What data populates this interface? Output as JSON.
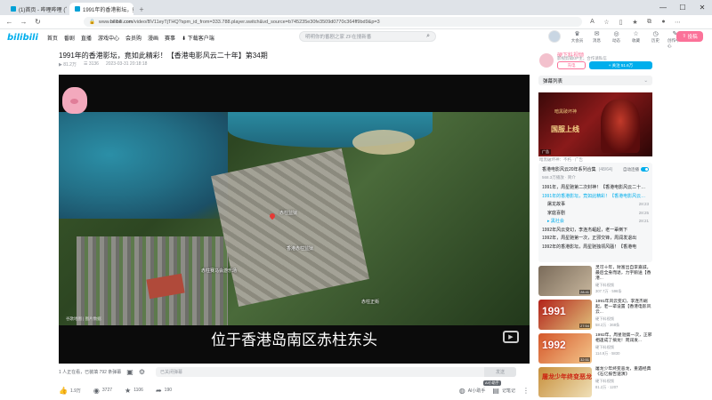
{
  "browser": {
    "tabs": [
      {
        "label": "(1)首页 - 哔哩哔哩 (゜-゜)つロ 干杯~-bilibili",
        "active": false
      },
      {
        "label": "1991年的香港影坛，竟如此精彩",
        "active": true
      }
    ],
    "url_prefix": "www.",
    "url_host": "bilibili.com",
    "url_rest": "/video/BV11eyTjTHQ?spm_id_from=333.788.player.switch&vd_source=b745235e30fe3509d0770c364ff9bd9&p=3"
  },
  "header": {
    "logo": "bilibili",
    "nav": [
      "首页",
      "番剧",
      "直播",
      "游戏中心",
      "会员购",
      "漫画",
      "赛事",
      "下载客户端"
    ],
    "search_placeholder": "明明你的番剧之家 ZF在搜新番",
    "icons": [
      {
        "label": "大会员"
      },
      {
        "label": "消息"
      },
      {
        "label": "动态"
      },
      {
        "label": "收藏"
      },
      {
        "label": "历史"
      },
      {
        "label": "创作中心"
      }
    ],
    "upload_label": "投稿"
  },
  "video": {
    "title": "1991年的香港影坛，竟如此精彩！【香港电影风云二十年】第34期",
    "views": "81.2万",
    "danmaku_count": "3136",
    "date": "2023-03-31 20:18:18",
    "subtitle": "位于香港岛南区赤柱东头",
    "map_labels": [
      "赤柱监狱",
      "香港赤柱监狱",
      "赤柱正街",
      "赤柱赛马会游乐场"
    ],
    "watermark": "谷歌地图 | 图片数据"
  },
  "danmaku_bar": {
    "status": "1 人正在看，已装填 792 条弹幕",
    "placeholder": "已关闭弹幕",
    "send": "发送"
  },
  "toolbar": {
    "like": "1.9万",
    "coin": "3727",
    "fav": "1106",
    "share": "190",
    "ai_badge": "AI小助手",
    "ai_label": "AI小助手",
    "notes": "记笔记",
    "more": "举报"
  },
  "up": {
    "name": "硬下料视频",
    "desc": "影视剪辑UP主，合作请私信",
    "charge": "充电",
    "follow": "+ 关注 51.6万"
  },
  "danmaku_list": {
    "label": "弹幕列表"
  },
  "ad": {
    "brand": "暗黑破坏神",
    "headline": "国服上线",
    "tag": "广告",
    "caption": "暗黑破坏神：不朽 · 广告"
  },
  "collection": {
    "title": "香港电影风云20年系列合集",
    "count": "(48/64)",
    "autoplay": "自动连播",
    "sub": "568.3万播放 · 简介",
    "episodes": [
      {
        "title": "1991年，周星驰第二次封神！【香港电影风云二十年】",
        "dur": "",
        "active": false,
        "sub": false
      },
      {
        "title": "1991年的香港影坛，竟如此精彩！【香港电影风云二十年】",
        "dur": "",
        "active": true,
        "sub": false
      },
      {
        "title": "屠龙故事",
        "dur": "28:23",
        "active": false,
        "sub": true
      },
      {
        "title": "家庭喜剧",
        "dur": "28:25",
        "active": false,
        "sub": true
      },
      {
        "title": "▸ 黑社会",
        "dur": "28:21",
        "active": true,
        "sub": true
      },
      {
        "title": "1992年风云变幻，李连杰崛起，老一辈倒下",
        "dur": "",
        "active": false,
        "sub": false
      },
      {
        "title": "1992年，周星驰第一次，正邪交锋，周润发退出",
        "dur": "",
        "active": false,
        "sub": false
      },
      {
        "title": "1992年的香港影坛，周星驰独领风骚！【香港电",
        "dur": "",
        "active": false,
        "sub": false
      }
    ]
  },
  "recommendations": [
    {
      "title": "灵可十年，财富出自李嘉诚，最后全身而退，力宇鹅送【香港...",
      "up": "硬下料视频",
      "stats": "307.7万 · 596条",
      "dur": "28:41",
      "big": ""
    },
    {
      "title": "1991年风云变幻，李连杰崛起，老一辈设置【香港电影风云...",
      "up": "硬下料视频",
      "stats": "58.2万 · 368条",
      "dur": "27:54",
      "big": "1991"
    },
    {
      "title": "1992年，周星驰第一次，正邪相逢成了搞龙！周润发...",
      "up": "硬下料视频",
      "stats": "114.9万 · 5830",
      "dur": "32:51",
      "big": "1992"
    },
    {
      "title": "屠龙少年终变恶龙，重遇经典《石亿报告速演》",
      "up": "硬下料视频",
      "stats": "81.2万 · 1207",
      "dur": "",
      "big": "屠龙少年终变恶龙"
    }
  ]
}
